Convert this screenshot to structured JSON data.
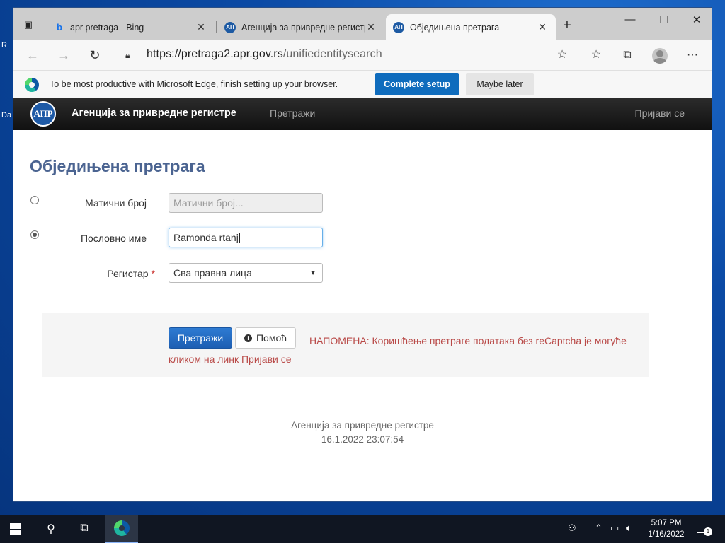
{
  "browser": {
    "tabs": [
      {
        "title": "apr pretraga - Bing",
        "icon": "bing-icon"
      },
      {
        "title": "Агенција за привредне регистр",
        "icon": "apr-icon"
      },
      {
        "title": "Обједињена претрага",
        "icon": "apr-icon"
      }
    ],
    "address": {
      "host": "https://pretraga2.apr.gov.rs",
      "path": "/unifiedentitysearch"
    }
  },
  "infobar": {
    "message": "To be most productive with Microsoft Edge, finish setting up your browser.",
    "complete_label": "Complete setup",
    "later_label": "Maybe later"
  },
  "site": {
    "logo_text": "АПР",
    "name": "Агенција за привредне регистре",
    "nav_search": "Претражи",
    "nav_login": "Пријави се"
  },
  "page": {
    "title": "Обједињена претрага",
    "fields": {
      "mb_label": "Матични број",
      "mb_placeholder": "Матични број...",
      "name_label": "Пословно име",
      "name_value": "Ramonda rtanj",
      "registry_label": "Регистар",
      "registry_required": "*",
      "registry_value": "Сва правна лица"
    },
    "search_button": "Претражи",
    "help_button": "Помоћ",
    "note": "НАПОМЕНА: Коришћење претраге података без reCaptcha је могуће кликом на линк Пријави се"
  },
  "footer": {
    "org": "Агенција за привредне регистре",
    "datetime": "16.1.2022 23:07:54"
  },
  "taskbar": {
    "time": "5:07 PM",
    "date": "1/16/2022",
    "notification_count": "1"
  },
  "colors": {
    "accent": "#0f6cbd",
    "site_title": "#4b6491",
    "note": "#b94a48"
  }
}
